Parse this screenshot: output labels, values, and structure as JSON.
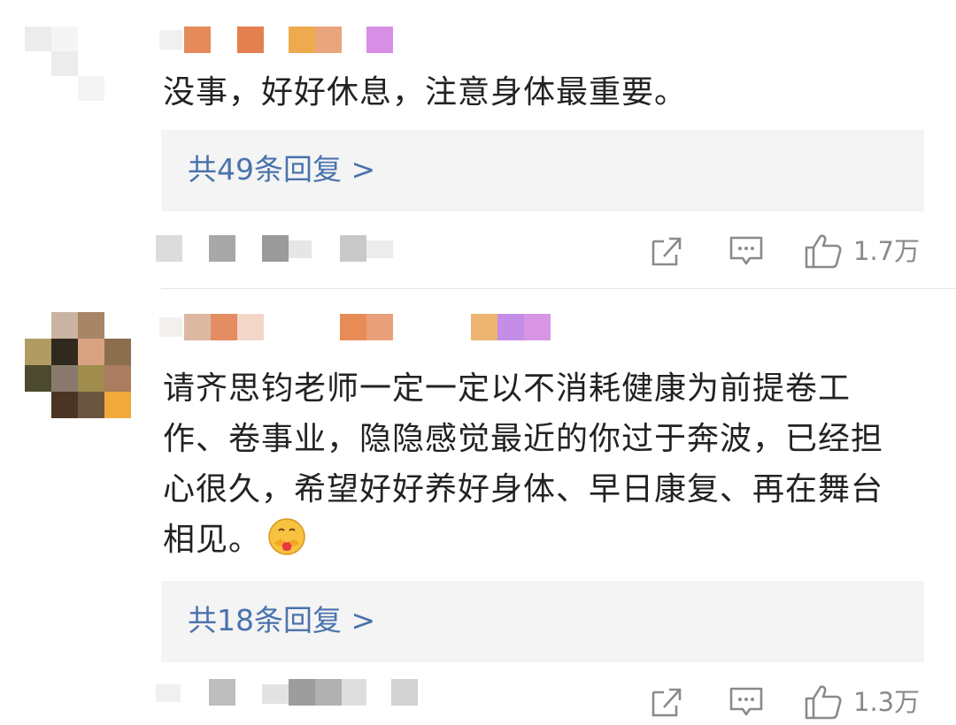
{
  "comments": [
    {
      "text": "没事，好好休息，注意身体最重要。",
      "replies_label": "共49条回复 >",
      "likes": "1.7万",
      "icons": [
        "share-icon",
        "comment-icon",
        "like-icon"
      ]
    },
    {
      "text": "请齐思钧老师一定一定以不消耗健康为前提卷工作、卷事业，隐隐感觉最近的你过于奔波，已经担心很久，希望好好养好身体、早日康复、再在舞台相见。",
      "emoji": "hug-emoji",
      "replies_label": "共18条回复 >",
      "likes": "1.3万",
      "icons": [
        "share-icon",
        "comment-icon",
        "like-icon"
      ]
    }
  ],
  "colors": {
    "reply_link": "#4a73ac",
    "reply_box_bg": "#f4f4f4",
    "text": "#222222",
    "meta": "#8a8a8a"
  }
}
